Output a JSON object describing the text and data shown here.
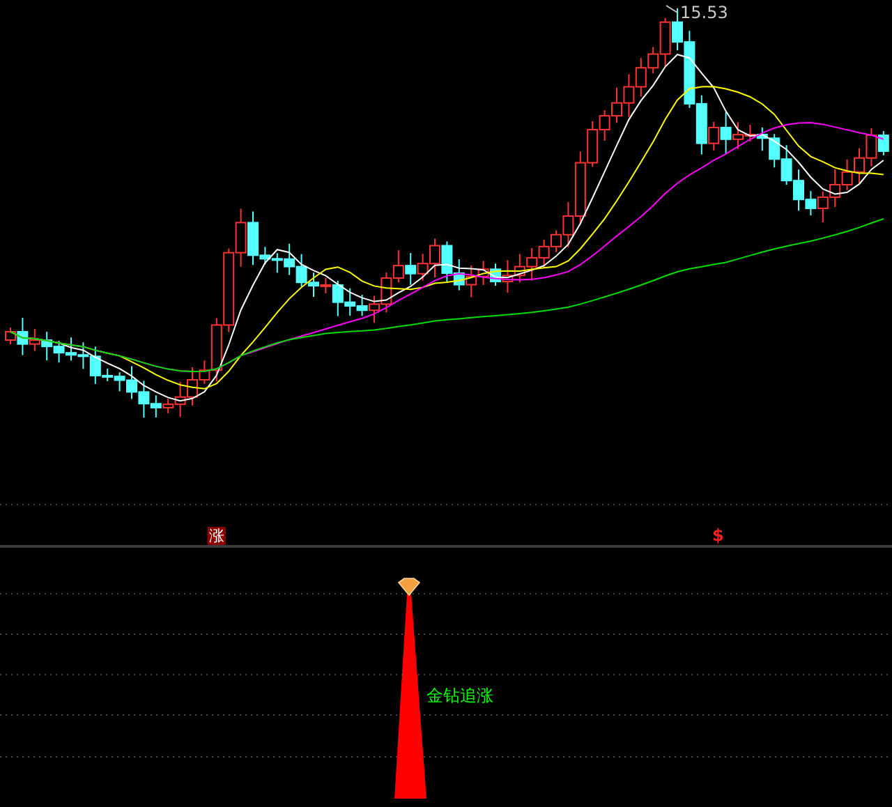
{
  "main_chart": {
    "high_label": "15.53",
    "signals": [
      {
        "kind": "box",
        "text": "涨"
      },
      {
        "kind": "arrow",
        "text": "$"
      }
    ]
  },
  "indicator": {
    "label": "金钻追涨"
  }
}
